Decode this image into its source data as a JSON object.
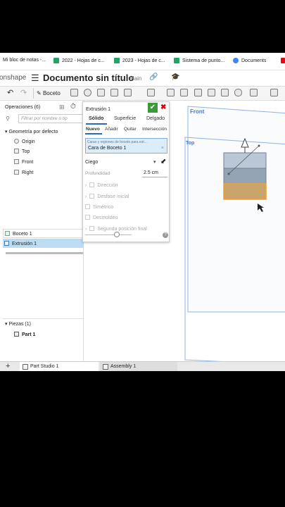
{
  "bookmarks": [
    {
      "label": "Mi bloc de notas -...",
      "icon": "notes-icon",
      "color": "#9e9e9e"
    },
    {
      "label": "2022 - Hojas de c...",
      "icon": "sheets-icon",
      "color": "#1fa463"
    },
    {
      "label": "2023 - Hojas de c...",
      "icon": "sheets-icon",
      "color": "#1fa463"
    },
    {
      "label": "Sistema de punto...",
      "icon": "sheets-icon",
      "color": "#1fa463"
    },
    {
      "label": "Documents",
      "icon": "docs-icon",
      "color": "#4285f4"
    }
  ],
  "app": {
    "brand": "onshape",
    "menu_icon": "☰",
    "doc_title": "Documento sin título",
    "branch": "Main",
    "link_icon": "🔗",
    "grad_icon": "🎓"
  },
  "toolbar": {
    "undo": "↶",
    "redo": "↷",
    "sketch_label": "Boceto"
  },
  "features": {
    "header": "Operaciones (6)",
    "filter_placeholder": "Filtrar por nombre o tip",
    "default_geometry": "Geometría por defecto",
    "items": [
      "Origin",
      "Top",
      "Front",
      "Right"
    ],
    "sketch": "Boceto 1",
    "extrude": "Extrusión 1",
    "parts_header": "Piezas (1)",
    "part": "Part 1"
  },
  "dialog": {
    "title": "Extrusión 1",
    "ok": "✔",
    "cancel": "✖",
    "tabs": [
      "Sólido",
      "Superficie",
      "Delgado"
    ],
    "ops": [
      "Nuevo",
      "Añadir",
      "Quitar",
      "Intersección"
    ],
    "selection_hint": "Caras y regiones de boceto para ext...",
    "selection_value": "Cara de Boceto 1",
    "selection_remove": "×",
    "end_type": "Ciego",
    "depth_label": "Profundidad",
    "depth_value": "2.5 cm",
    "options": [
      "Dirección",
      "Desfase inicial",
      "Simétrico",
      "Desmoldeo",
      "Segunda posición final"
    ],
    "help": "?"
  },
  "viewport": {
    "front_label": "Front",
    "top_label": "Top",
    "cursor_index": "1"
  },
  "bottom_tabs": {
    "add": "+",
    "part_studio": "Part Studio 1",
    "assembly": "Assembly 1"
  },
  "colors": {
    "accent": "#2b67c4",
    "selected_row": "#bcdcf3",
    "ok_green": "#3a9a3a",
    "plane_blue": "#8fb3df",
    "preview_orange": "#f0a030"
  }
}
